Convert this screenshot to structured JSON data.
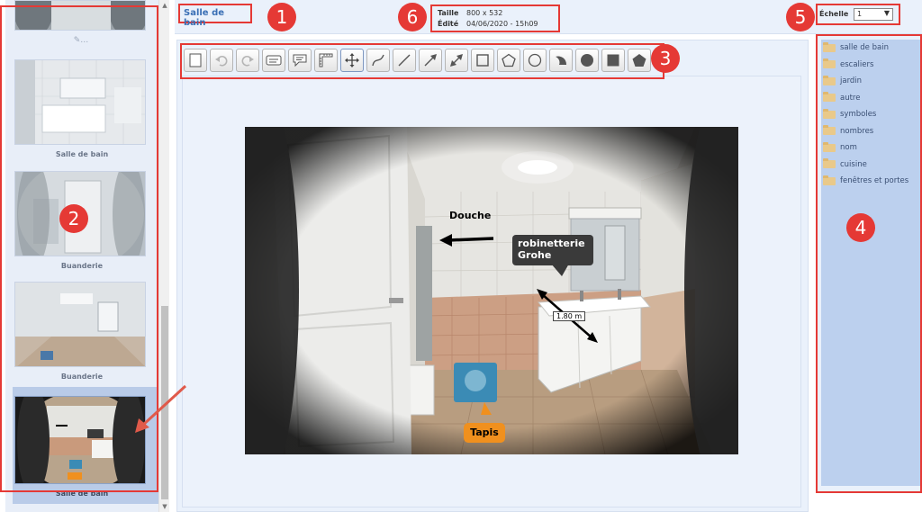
{
  "header": {
    "title": "Salle de bain",
    "size_label": "Taille",
    "size_value": "800 x 532",
    "edited_label": "Édité",
    "edited_value": "04/06/2020 - 15h09",
    "scale_label": "Échelle",
    "scale_value": "1"
  },
  "badges": [
    "1",
    "2",
    "3",
    "4",
    "5",
    "6"
  ],
  "sidebar": {
    "top_icon": "edit-icon",
    "thumbnails": [
      {
        "caption": "Salle de bain"
      },
      {
        "caption": "Buanderie"
      },
      {
        "caption": "Buanderie"
      },
      {
        "caption": "Salle de bain"
      }
    ]
  },
  "toolbar": {
    "tools": [
      "new-page",
      "undo",
      "redo",
      "text-label",
      "speech-bubble",
      "ruler",
      "move",
      "curve",
      "line",
      "arrow",
      "double-arrow",
      "rectangle",
      "pentagon-outline",
      "circle",
      "sector",
      "filled-circle",
      "filled-square",
      "filled-pentagon"
    ]
  },
  "photo": {
    "annotations": {
      "douche": "Douche",
      "robinetterie_1": "robinetterie",
      "robinetterie_2": "Grohe",
      "measure": "1.80 m",
      "tapis": "Tapis"
    }
  },
  "folders": [
    "salle de bain",
    "escaliers",
    "jardin",
    "autre",
    "symboles",
    "nombres",
    "nom",
    "cuisine",
    "fenêtres et portes"
  ],
  "colors": {
    "highlight": "#e53935",
    "panel": "#eaf1fb",
    "folder_list": "#bcd0ee",
    "title": "#3a6fb5",
    "orange_tag": "#f0901e"
  }
}
